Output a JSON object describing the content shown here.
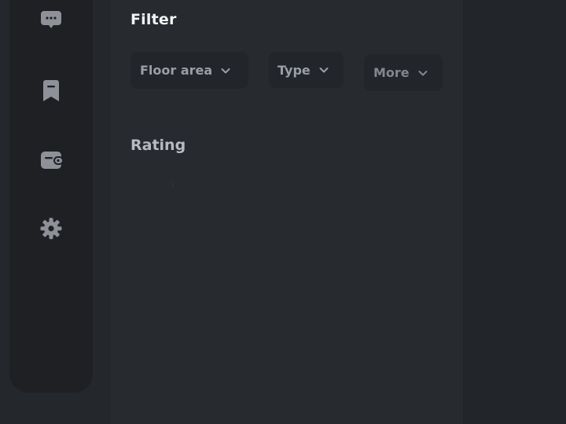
{
  "nav": {
    "items": [
      {
        "icon": "chat-bubble-icon"
      },
      {
        "icon": "bookmark-icon"
      },
      {
        "icon": "wallet-icon"
      },
      {
        "icon": "gear-icon"
      }
    ]
  },
  "filter": {
    "title": "Filter",
    "chips": [
      {
        "label": "Floor area",
        "icon": "chevron-down-icon"
      },
      {
        "label": "Type",
        "icon": "chevron-down-icon"
      },
      {
        "label": "More",
        "icon": "chevron-down-icon"
      }
    ],
    "rating_label": "Rating"
  },
  "colors": {
    "background": "#24272c",
    "nav_rail": "#1e2024",
    "panel": "#272a2f",
    "chip": "#22252a",
    "icon": "#8e9198",
    "title_text": "#f3f4f6",
    "muted_text": "#9a9ea6"
  }
}
